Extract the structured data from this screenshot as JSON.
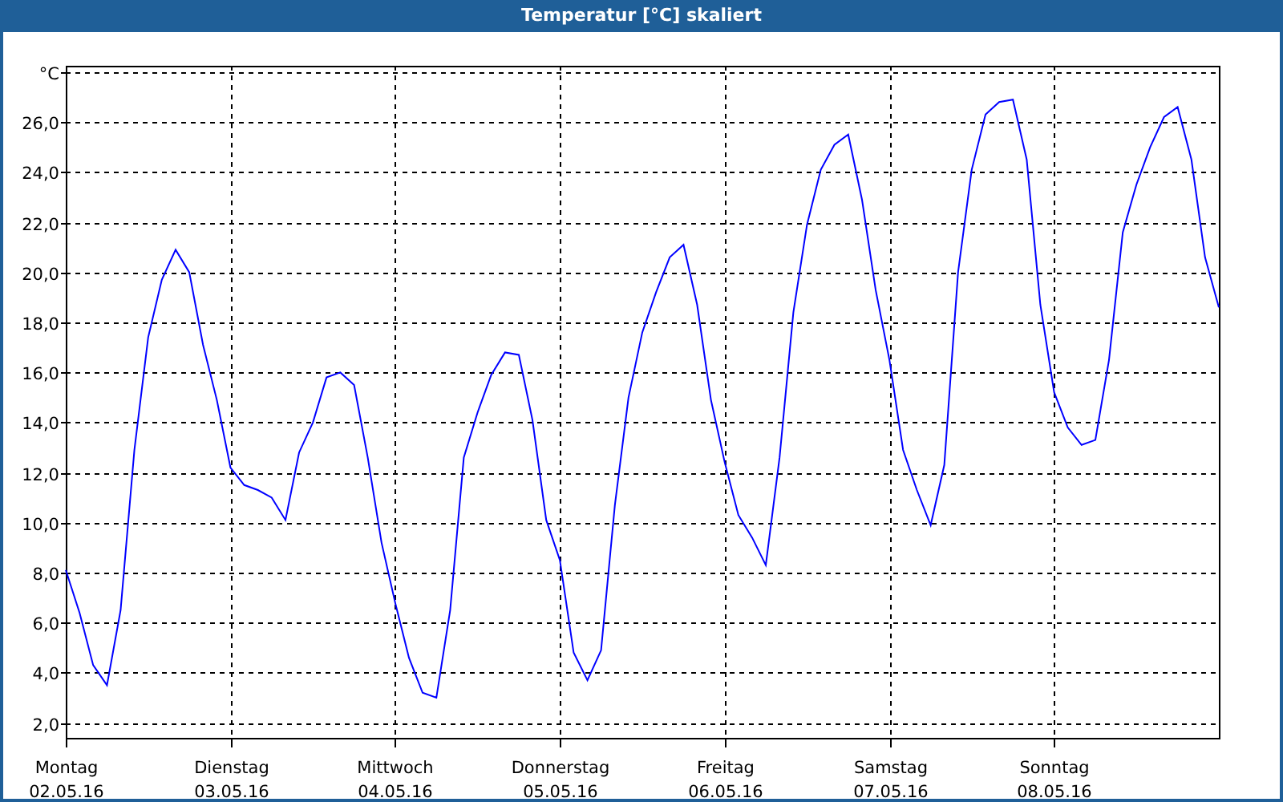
{
  "window": {
    "title": "Temperatur [°C] skaliert"
  },
  "chart": {
    "chart_data": {
      "type": "line",
      "grid": true,
      "ylim": [
        1.4,
        28.25
      ],
      "yticks": [
        {
          "value": 2,
          "label": "2,0"
        },
        {
          "value": 4,
          "label": "4,0"
        },
        {
          "value": 6,
          "label": "6,0"
        },
        {
          "value": 8,
          "label": "8,0"
        },
        {
          "value": 10,
          "label": "10,0"
        },
        {
          "value": 12,
          "label": "12,0"
        },
        {
          "value": 14,
          "label": "14,0"
        },
        {
          "value": 16,
          "label": "16,0"
        },
        {
          "value": 18,
          "label": "18,0"
        },
        {
          "value": 20,
          "label": "20,0"
        },
        {
          "value": 22,
          "label": "22,0"
        },
        {
          "value": 24,
          "label": "24,0"
        },
        {
          "value": 26,
          "label": "26,0"
        },
        {
          "value": 28,
          "label": "°C"
        }
      ],
      "categories": [
        "Montag\n02.05.16",
        null,
        null,
        null,
        null,
        null,
        null,
        null,
        null,
        null,
        null,
        null,
        "Dienstag\n03.05.16",
        null,
        null,
        null,
        null,
        null,
        null,
        null,
        null,
        null,
        null,
        null,
        "Mittwoch\n04.05.16",
        null,
        null,
        null,
        null,
        null,
        null,
        null,
        null,
        null,
        null,
        null,
        "Donnerstag\n05.05.16",
        null,
        null,
        null,
        null,
        null,
        null,
        null,
        null,
        null,
        null,
        null,
        "Freitag\n06.05.16",
        null,
        null,
        null,
        null,
        null,
        null,
        null,
        null,
        null,
        null,
        null,
        "Samstag\n07.05.16",
        null,
        null,
        null,
        null,
        null,
        null,
        null,
        null,
        null,
        null,
        null,
        "Sonntag\n08.05.16",
        null,
        null,
        null,
        null,
        null,
        null,
        null,
        null,
        null,
        null,
        null,
        null
      ],
      "series": [
        {
          "color": "#0000ff",
          "values": [
            8.1,
            6.4,
            4.3,
            3.5,
            6.5,
            12.9,
            17.4,
            19.7,
            20.9,
            20.0,
            17.1,
            14.9,
            12.2,
            11.5,
            11.3,
            11.0,
            10.1,
            12.8,
            14.0,
            15.8,
            16.0,
            15.5,
            12.6,
            9.2,
            6.8,
            4.6,
            3.2,
            3.0,
            6.5,
            12.6,
            14.4,
            15.9,
            16.8,
            16.7,
            14.1,
            10.1,
            8.5,
            4.8,
            3.7,
            4.9,
            10.7,
            15.0,
            17.6,
            19.2,
            20.6,
            21.1,
            18.7,
            14.9,
            12.4,
            10.3,
            9.4,
            8.3,
            12.6,
            18.4,
            21.9,
            24.1,
            25.1,
            25.5,
            22.9,
            19.3,
            16.5,
            12.9,
            11.3,
            9.9,
            12.3,
            20.0,
            24.1,
            26.3,
            26.8,
            26.9,
            24.5,
            18.7,
            15.2,
            13.8,
            13.1,
            13.3,
            16.5,
            21.6,
            23.5,
            25.0,
            26.2,
            26.6,
            24.5,
            20.6,
            18.6
          ]
        }
      ]
    }
  }
}
